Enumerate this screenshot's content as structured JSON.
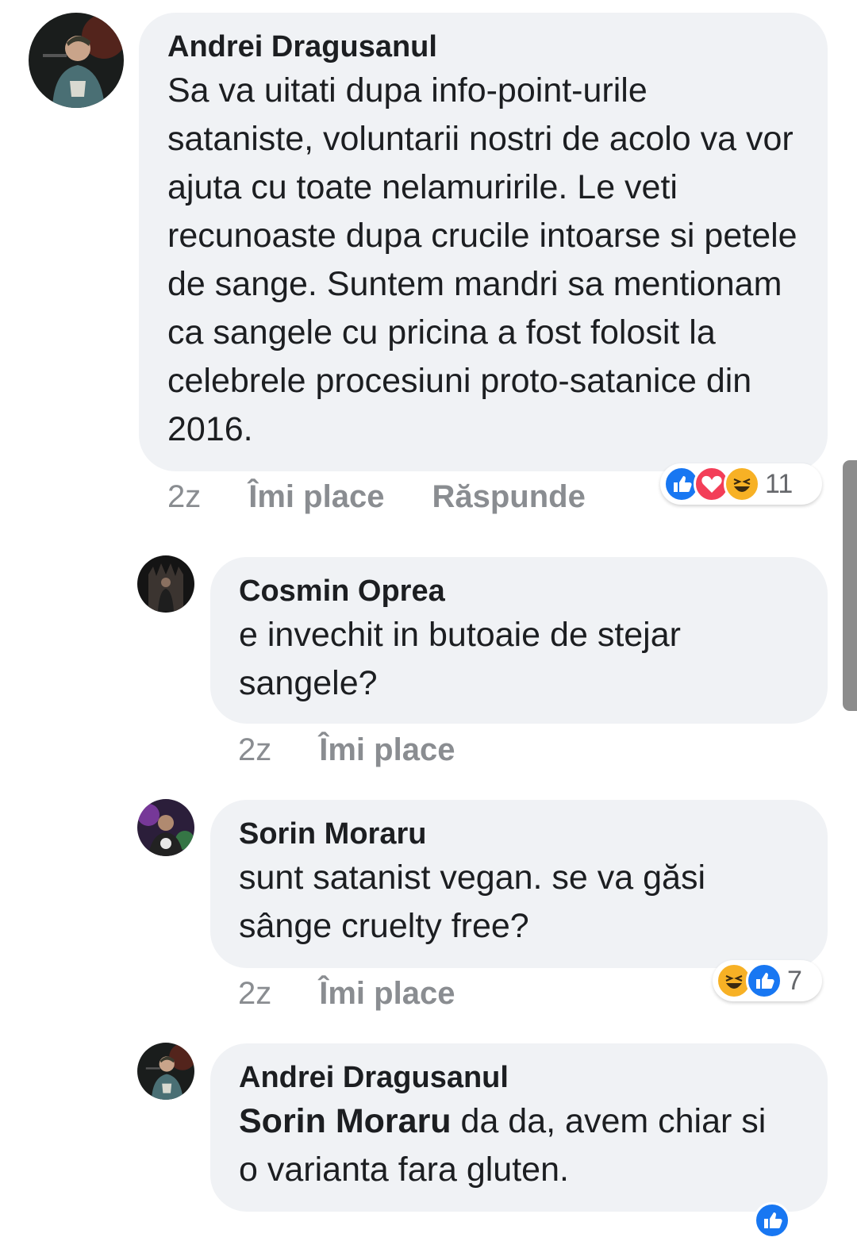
{
  "comments": [
    {
      "author": "Andrei Dragusanul",
      "text": "Sa va uitati dupa info-point-urile sataniste, voluntarii nostri de acolo va vor ajuta cu toate nelamuririle. Le veti recunoaste dupa crucile intoarse si petele de sange. Suntem mandri sa mentionam ca sangele cu pricina a fost folosit la celebrele procesiuni proto-satanice din 2016.",
      "time": "2z",
      "like_label": "Îmi place",
      "reply_label": "Răspunde",
      "reactions": [
        "like-icon",
        "love-icon",
        "haha-icon"
      ],
      "reaction_count": "11"
    },
    {
      "author": "Cosmin Oprea",
      "text": "e invechit in butoaie de stejar sangele?",
      "time": "2z",
      "like_label": "Îmi place"
    },
    {
      "author": "Sorin Moraru",
      "text": "sunt satanist vegan. se va găsi sânge cruelty free?",
      "time": "2z",
      "like_label": "Îmi place",
      "reactions": [
        "haha-icon",
        "like-icon"
      ],
      "reaction_count": "7"
    },
    {
      "author": "Andrei Dragusanul",
      "mention": "Sorin Moraru",
      "text": " da da, avem chiar si o varianta fara gluten."
    }
  ],
  "colors": {
    "bubble": "#f0f2f5",
    "meta": "#8a8d91",
    "like_blue": "#1877f2",
    "love_red": "#f33e58",
    "haha_yellow": "#f7b125"
  }
}
